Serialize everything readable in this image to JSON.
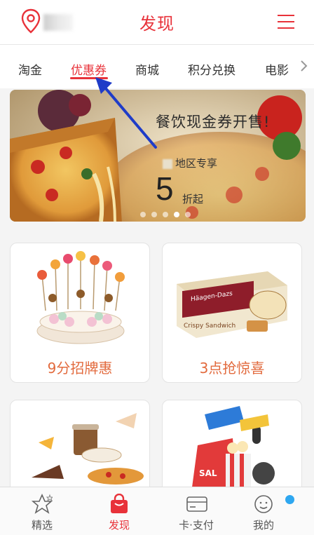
{
  "header": {
    "title": "发现",
    "location_icon": "location-pin-icon",
    "location_text": "",
    "menu_icon": "menu-icon"
  },
  "tabs": [
    {
      "label": "淘金"
    },
    {
      "label": "优惠券",
      "active": true
    },
    {
      "label": "商城"
    },
    {
      "label": "积分兑换"
    },
    {
      "label": "电影"
    }
  ],
  "banner": {
    "title": "餐饮现金券开售!",
    "subtitle": "地区专享",
    "number": "5",
    "suffix": "折起",
    "page_count": 5,
    "active_page": 4
  },
  "cards": [
    {
      "label": "9分招牌惠",
      "image": "dessert-cake-image"
    },
    {
      "label": "3点抢惊喜",
      "image": "ice-cream-box-image"
    },
    {
      "label": "",
      "image": "coffee-pizza-image"
    },
    {
      "label": "",
      "image": "shopping-popcorn-image"
    }
  ],
  "bottom_nav": [
    {
      "label": "精选",
      "icon": "star-icon"
    },
    {
      "label": "发现",
      "icon": "bag-icon",
      "active": true
    },
    {
      "label": "卡·支付",
      "icon": "card-icon"
    },
    {
      "label": "我的",
      "icon": "user-icon"
    }
  ],
  "colors": {
    "accent": "#e8323a",
    "card_label": "#e26a3d",
    "badge": "#2ea7f0",
    "annotation_arrow": "#1f3cc8"
  }
}
